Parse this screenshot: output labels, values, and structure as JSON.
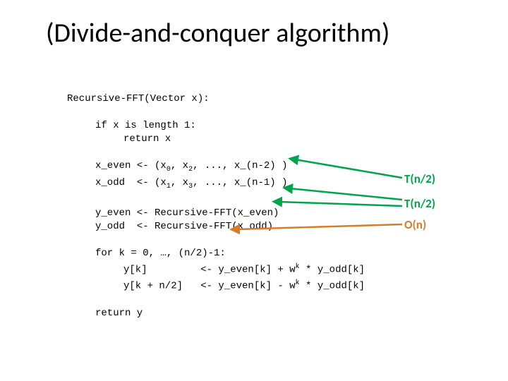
{
  "title": "(Divide-and-conquer algorithm)",
  "code": {
    "sig": "Recursive-FFT(Vector x):",
    "base_if": "if x is length 1:",
    "base_ret": "return x",
    "split_even_a": "x_even <- (x",
    "split_even_b": ", x",
    "split_even_c": ", ..., x_(n-2) )",
    "split_odd_a": "x_odd  <- (x",
    "split_odd_b": ", x",
    "split_odd_c": ", ..., x_(n-1) )",
    "rec_even": "y_even <- Recursive-FFT(x_even)",
    "rec_odd": "y_odd  <- Recursive-FFT(x_odd)",
    "for_head": "for k = 0, …, (n/2)-1:",
    "for_l1a": "y[k]         <- y_even[k] + w",
    "for_l1b": " * y_odd[k]",
    "for_l2a": "y[k + n/2]   <- y_even[k] - w",
    "for_l2b": " * y_odd[k]",
    "ret": "return y",
    "s0": "0",
    "s1": "1",
    "s2": "2",
    "s3": "3",
    "sk": "k"
  },
  "annot": {
    "tn2a": "T(n/2)",
    "tn2b": "T(n/2)",
    "on_o": "O",
    "on_n": "(n)"
  },
  "colors": {
    "green": "#00a44a",
    "orange": "#d97c28"
  }
}
